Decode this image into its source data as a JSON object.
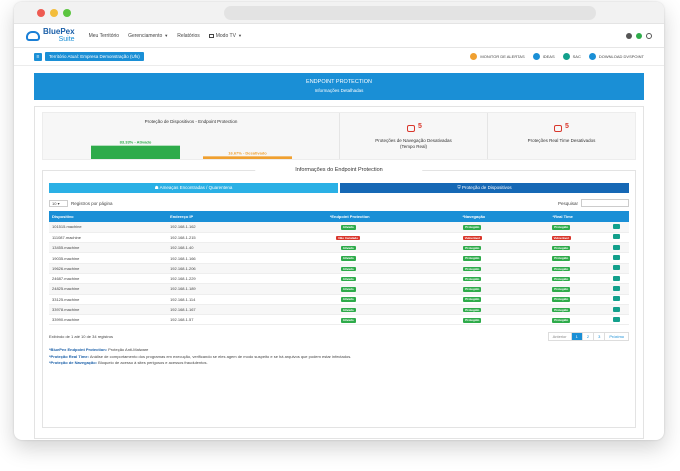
{
  "brand": {
    "name": "BluePex",
    "suite": "Suite"
  },
  "nav": {
    "items": [
      {
        "label": "Meu Território",
        "caret": false,
        "icon": false
      },
      {
        "label": "Gerenciamento",
        "caret": true,
        "icon": false
      },
      {
        "label": "Relatórios",
        "caret": false,
        "icon": false
      },
      {
        "label": "Modo TV",
        "caret": true,
        "icon": true
      }
    ]
  },
  "subbar": {
    "territory": "Território Atual: Empresa Demonstração (Ufs)",
    "items": [
      {
        "label": "MONITOR DE ALERTAS",
        "color": "#f0a030"
      },
      {
        "label": "IDEAS",
        "color": "#1a8fd6"
      },
      {
        "label": "SAC",
        "color": "#13a08c"
      },
      {
        "label": "DOWNLOAD DVSPOINT",
        "color": "#1a8fd6"
      }
    ]
  },
  "banner": {
    "title": "ENDPOINT PROTECTION",
    "subtitle": "Informações Detalhadas"
  },
  "stats": {
    "chart_title": "Proteção de Dispositivos - Endpoint Protection",
    "boxes": [
      {
        "count": "5",
        "label": "Proteções de Navegação Desativadas",
        "label2": "(Tempo Real)"
      },
      {
        "count": "5",
        "label": "Proteções Real Time Desativados",
        "label2": ""
      }
    ]
  },
  "chart_data": {
    "type": "bar",
    "title": "Proteção de Dispositivos - Endpoint Protection",
    "categories": [
      "Ativado",
      "Desativado"
    ],
    "values": [
      83.33,
      16.67
    ],
    "labels": [
      "83.33% - Ativado",
      "16.67% - Desativado"
    ],
    "colors": [
      "#2eab4a",
      "#f0a030"
    ],
    "ylim": [
      0,
      100
    ]
  },
  "section": {
    "title": "Informações do Endpoint Protection",
    "tabs": [
      "Ameaças Encontradas / Quarentena",
      "Proteção de Dispositivos"
    ]
  },
  "controls": {
    "length": "10",
    "length_label": "Registros por página",
    "search_label": "Pesquisar"
  },
  "table": {
    "headers": [
      "Dispositivo",
      "Endereço IP",
      "*Endpoint Protection",
      "*Navegação",
      "*Real Time",
      ""
    ],
    "rows": [
      {
        "device": "101515.machine",
        "ip": "192.168.1.162",
        "ep": "Ativado",
        "ep_ok": true,
        "nav": "Protegido",
        "nav_ok": true,
        "rt": "Protegido",
        "rt_ok": true
      },
      {
        "device": "111087.machine",
        "ip": "192.168.1.215",
        "ep": "Não Instalado",
        "ep_ok": false,
        "nav": "Vulnerável",
        "nav_ok": false,
        "rt": "Vulnerável",
        "rt_ok": false
      },
      {
        "device": "13455.machine",
        "ip": "192.168.1.40",
        "ep": "Ativado",
        "ep_ok": true,
        "nav": "Protegido",
        "nav_ok": true,
        "rt": "Protegido",
        "rt_ok": true
      },
      {
        "device": "19035.machine",
        "ip": "192.168.1.166",
        "ep": "Ativado",
        "ep_ok": true,
        "nav": "Protegido",
        "nav_ok": true,
        "rt": "Protegido",
        "rt_ok": true
      },
      {
        "device": "19626.machine",
        "ip": "192.168.1.206",
        "ep": "Ativado",
        "ep_ok": true,
        "nav": "Protegido",
        "nav_ok": true,
        "rt": "Protegido",
        "rt_ok": true
      },
      {
        "device": "24687.machine",
        "ip": "192.168.1.229",
        "ep": "Ativado",
        "ep_ok": true,
        "nav": "Protegido",
        "nav_ok": true,
        "rt": "Protegido",
        "rt_ok": true
      },
      {
        "device": "24825.machine",
        "ip": "192.168.1.189",
        "ep": "Ativado",
        "ep_ok": true,
        "nav": "Protegido",
        "nav_ok": true,
        "rt": "Protegido",
        "rt_ok": true
      },
      {
        "device": "33125.machine",
        "ip": "192.168.1.114",
        "ep": "Ativado",
        "ep_ok": true,
        "nav": "Protegido",
        "nav_ok": true,
        "rt": "Protegido",
        "rt_ok": true
      },
      {
        "device": "33978.machine",
        "ip": "192.168.1.167",
        "ep": "Ativado",
        "ep_ok": true,
        "nav": "Protegido",
        "nav_ok": true,
        "rt": "Protegido",
        "rt_ok": true
      },
      {
        "device": "33990.machine",
        "ip": "192.168.1.57",
        "ep": "Ativado",
        "ep_ok": true,
        "nav": "Protegido",
        "nav_ok": true,
        "rt": "Protegido",
        "rt_ok": true
      }
    ]
  },
  "footer": {
    "info": "Exibindo de 1 até 10 de 34 registros",
    "pager": [
      "Anterior",
      "1",
      "2",
      "3",
      "Próximo"
    ],
    "active_page": "1"
  },
  "legend": [
    {
      "term": "*BluePex Endpoint Protection:",
      "text": "Proteção Anti-Malware"
    },
    {
      "term": "*Proteção Real Time:",
      "text": "Análise de comportamento dos programas em execução, verificando se eles agem de modo suspeito e se há arquivos que podem estar infectados."
    },
    {
      "term": "*Proteção de Navegação:",
      "text": "Bloqueio de acesso à sites perigosos e acessos fraudulentos."
    }
  ]
}
